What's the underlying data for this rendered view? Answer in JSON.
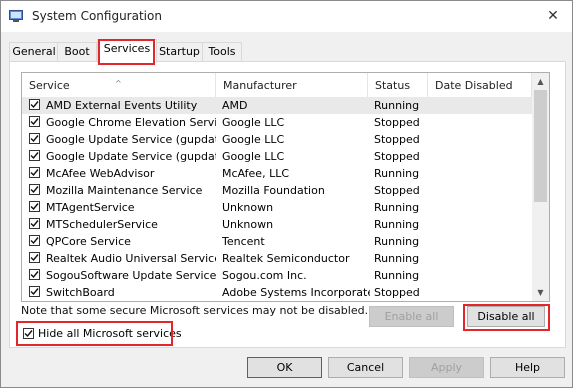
{
  "window": {
    "title": "System Configuration",
    "close_glyph": "✕"
  },
  "tabs": [
    {
      "label": "General",
      "active": false
    },
    {
      "label": "Boot",
      "active": false
    },
    {
      "label": "Services",
      "active": true
    },
    {
      "label": "Startup",
      "active": false
    },
    {
      "label": "Tools",
      "active": false
    }
  ],
  "table": {
    "columns": [
      "Service",
      "Manufacturer",
      "Status",
      "Date Disabled"
    ],
    "sort_glyph": "^",
    "rows": [
      {
        "service": "AMD External Events Utility",
        "manufacturer": "AMD",
        "status": "Running",
        "checked": true,
        "selected": true
      },
      {
        "service": "Google Chrome Elevation Service",
        "manufacturer": "Google LLC",
        "status": "Stopped",
        "checked": true,
        "selected": false
      },
      {
        "service": "Google Update Service (gupdate)",
        "manufacturer": "Google LLC",
        "status": "Stopped",
        "checked": true,
        "selected": false
      },
      {
        "service": "Google Update Service (gupdatem)",
        "manufacturer": "Google LLC",
        "status": "Stopped",
        "checked": true,
        "selected": false
      },
      {
        "service": "McAfee WebAdvisor",
        "manufacturer": "McAfee, LLC",
        "status": "Running",
        "checked": true,
        "selected": false
      },
      {
        "service": "Mozilla Maintenance Service",
        "manufacturer": "Mozilla Foundation",
        "status": "Stopped",
        "checked": true,
        "selected": false
      },
      {
        "service": "MTAgentService",
        "manufacturer": "Unknown",
        "status": "Running",
        "checked": true,
        "selected": false
      },
      {
        "service": "MTSchedulerService",
        "manufacturer": "Unknown",
        "status": "Running",
        "checked": true,
        "selected": false
      },
      {
        "service": "QPCore Service",
        "manufacturer": "Tencent",
        "status": "Running",
        "checked": true,
        "selected": false
      },
      {
        "service": "Realtek Audio Universal Service",
        "manufacturer": "Realtek Semiconductor",
        "status": "Running",
        "checked": true,
        "selected": false
      },
      {
        "service": "SogouSoftware Update Service ...",
        "manufacturer": "Sogou.com Inc.",
        "status": "Running",
        "checked": true,
        "selected": false
      },
      {
        "service": "SwitchBoard",
        "manufacturer": "Adobe Systems Incorporated",
        "status": "Stopped",
        "checked": true,
        "selected": false
      }
    ]
  },
  "note": "Note that some secure Microsoft services may not be disabled.",
  "buttons": {
    "enable_all": "Enable all",
    "disable_all": "Disable all",
    "ok": "OK",
    "cancel": "Cancel",
    "apply": "Apply",
    "help": "Help"
  },
  "hide_ms": {
    "label": "Hide all Microsoft services",
    "checked": true
  },
  "colors": {
    "highlight": "#e2262c",
    "accent": "#0078d7"
  }
}
